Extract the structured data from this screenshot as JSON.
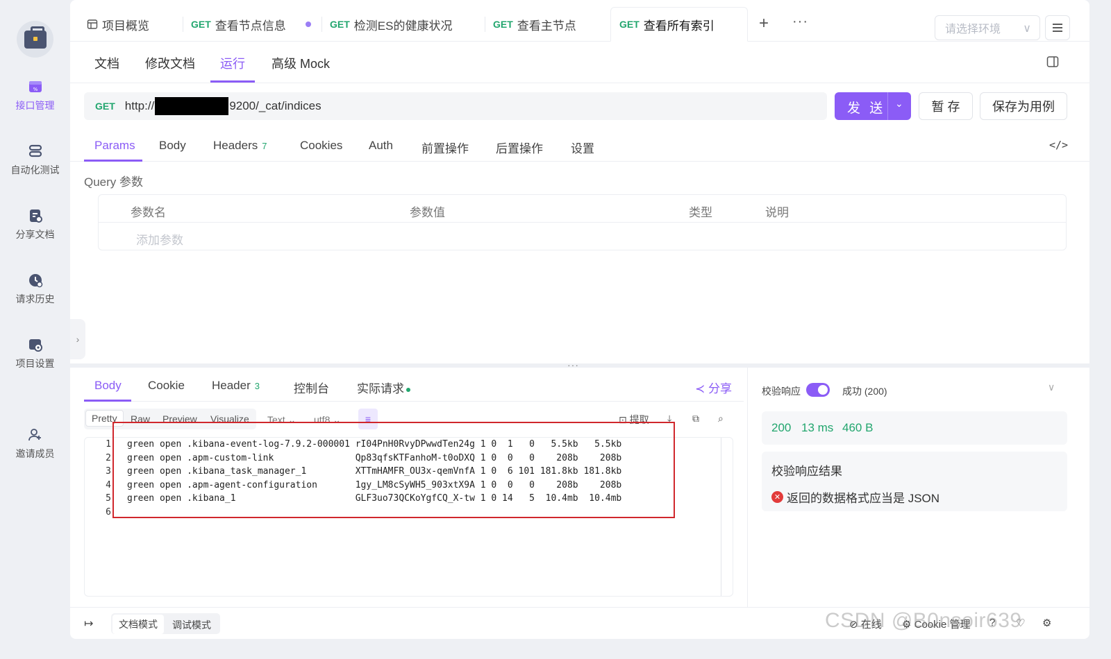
{
  "sidebar": {
    "items": [
      {
        "label": "接口管理",
        "icon": "api-icon",
        "active": true
      },
      {
        "label": "自动化测试",
        "icon": "automation-icon",
        "active": false
      },
      {
        "label": "分享文档",
        "icon": "share-doc-icon",
        "active": false
      },
      {
        "label": "请求历史",
        "icon": "history-icon",
        "active": false
      },
      {
        "label": "项目设置",
        "icon": "project-settings-icon",
        "active": false
      },
      {
        "label": "邀请成员",
        "icon": "invite-member-icon",
        "active": false
      }
    ]
  },
  "tabs": [
    {
      "method": "",
      "label": "项目概览"
    },
    {
      "method": "GET",
      "label": "查看节点信息"
    },
    {
      "method": "GET",
      "label": "检测ES的健康状况"
    },
    {
      "method": "GET",
      "label": "查看主节点"
    },
    {
      "method": "GET",
      "label": "查看所有索引"
    }
  ],
  "env_placeholder": "请选择环境",
  "subtabs": [
    "文档",
    "修改文档",
    "运行",
    "高级 Mock"
  ],
  "request": {
    "method": "GET",
    "url_prefix": "http://",
    "url_suffix": "9200/_cat/indices"
  },
  "buttons": {
    "send": "发 送",
    "save_temp": "暂 存",
    "save_case": "保存为用例"
  },
  "param_tabs": [
    {
      "label": "Params",
      "count": ""
    },
    {
      "label": "Body",
      "count": ""
    },
    {
      "label": "Headers",
      "count": "7"
    },
    {
      "label": "Cookies",
      "count": ""
    },
    {
      "label": "Auth",
      "count": ""
    },
    {
      "label": "前置操作",
      "count": ""
    },
    {
      "label": "后置操作",
      "count": ""
    },
    {
      "label": "设置",
      "count": ""
    }
  ],
  "query": {
    "label": "Query 参数",
    "headers": [
      "参数名",
      "参数值",
      "类型",
      "说明"
    ],
    "add_placeholder": "添加参数"
  },
  "response_tabs": [
    {
      "label": "Body",
      "count": ""
    },
    {
      "label": "Cookie",
      "count": ""
    },
    {
      "label": "Header",
      "count": "3"
    },
    {
      "label": "控制台",
      "count": ""
    },
    {
      "label": "实际请求",
      "count": ""
    }
  ],
  "share_label": "分享",
  "format_buttons": [
    "Pretty",
    "Raw",
    "Preview",
    "Visualize"
  ],
  "format_selects": {
    "type": "Text",
    "encoding": "utf8"
  },
  "extract_label": "提取",
  "response_lines": [
    {
      "n": "1",
      "text": "green open .kibana-event-log-7.9.2-000001 rI04PnH0RvyDPwwdTen24g 1 0  1   0   5.5kb   5.5kb"
    },
    {
      "n": "2",
      "text": "green open .apm-custom-link               Qp83qfsKTFanhoM-t0oDXQ 1 0  0   0    208b    208b"
    },
    {
      "n": "3",
      "text": "green open .kibana_task_manager_1         XTTmHAMFR_OU3x-qemVnfA 1 0  6 101 181.8kb 181.8kb"
    },
    {
      "n": "4",
      "text": "green open .apm-agent-configuration       1gy_LM8cSyWH5_903xtX9A 1 0  0   0    208b    208b"
    },
    {
      "n": "5",
      "text": "green open .kibana_1                      GLF3uo73QCKoYgfCQ_X-tw 1 0 14   5  10.4mb  10.4mb"
    },
    {
      "n": "6",
      "text": ""
    }
  ],
  "validation": {
    "label": "校验响应",
    "enabled": true,
    "status": "成功 (200)",
    "code": "200",
    "time": "13 ms",
    "size": "460 B",
    "result_title": "校验响应结果",
    "error": "返回的数据格式应当是 JSON"
  },
  "footer": {
    "modes": [
      "文档模式",
      "调试模式"
    ],
    "online": "在线",
    "cookie": "Cookie 管理"
  },
  "watermark": "CSDN @B0nsoir639",
  "colors": {
    "accent": "#8b5cf6",
    "method_get": "#22a66e",
    "error": "#e23b3b",
    "highlight_box": "#d0272c"
  }
}
